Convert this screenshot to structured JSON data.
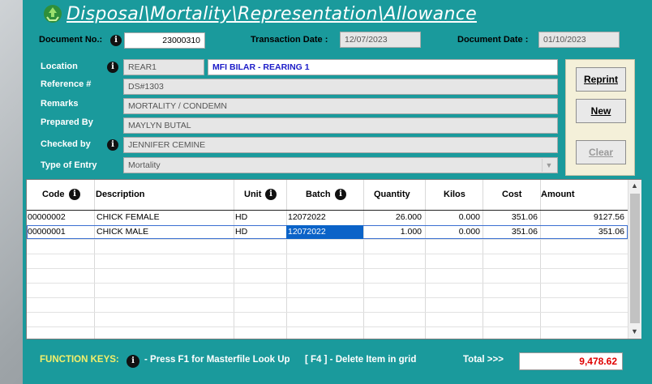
{
  "title": "Disposal\\Mortality\\Representation\\Allowance",
  "header": {
    "document_no_label": "Document No.:",
    "document_no": "23000310",
    "transaction_date_label": "Transaction Date :",
    "transaction_date": "12/07/2023",
    "document_date_label": "Document Date :",
    "document_date": "01/10/2023"
  },
  "form": {
    "location_label": "Location",
    "location_code": "REAR1",
    "location_name": "MFI BILAR - REARING 1",
    "reference_label": "Reference #",
    "reference": "DS#1303",
    "remarks_label": "Remarks",
    "remarks": "MORTALITY / CONDEMN",
    "prepared_by_label": "Prepared By",
    "prepared_by": "MAYLYN BUTAL",
    "checked_by_label": "Checked by",
    "checked_by": "JENNIFER CEMINE",
    "entry_type_label": "Type of Entry",
    "entry_type": "Mortality"
  },
  "buttons": {
    "reprint": "Reprint",
    "new": "New",
    "clear": "Clear"
  },
  "grid": {
    "columns": [
      "Code",
      "Description",
      "Unit",
      "Batch",
      "Quantity",
      "Kilos",
      "Cost",
      "Amount"
    ],
    "rows": [
      {
        "code": "00000002",
        "description": "CHICK FEMALE",
        "unit": "HD",
        "batch": "12072022",
        "quantity": "26.000",
        "kilos": "0.000",
        "cost": "351.06",
        "amount": "9127.56"
      },
      {
        "code": "00000001",
        "description": "CHICK MALE",
        "unit": "HD",
        "batch": "12072022",
        "quantity": "1.000",
        "kilos": "0.000",
        "cost": "351.06",
        "amount": "351.06"
      }
    ]
  },
  "footer": {
    "function_keys_label": "FUNCTION KEYS:",
    "f1_hint": "- Press F1 for Masterfile Look Up",
    "f4_hint": "[ F4 ] - Delete Item in grid",
    "total_label": "Total >>>",
    "total_value": "9,478.62"
  },
  "colors": {
    "window_bg": "#1a9a9c",
    "total_text": "#e00000",
    "location_name_text": "#1c1cc8",
    "function_keys_text": "#f4f06a"
  }
}
